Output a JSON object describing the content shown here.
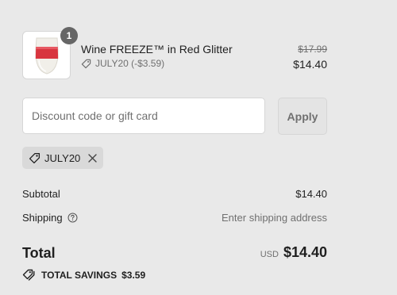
{
  "cart": {
    "item": {
      "quantity": "1",
      "title": "Wine FREEZE™ in Red Glitter",
      "discount": "JULY20 (-$3.59)",
      "original_price": "$17.99",
      "price": "$14.40",
      "image_icon": "wine-glass-image"
    }
  },
  "discount": {
    "placeholder": "Discount code or gift card",
    "value": "",
    "apply_label": "Apply",
    "applied_code": "JULY20"
  },
  "summary": {
    "subtotal_label": "Subtotal",
    "subtotal_value": "$14.40",
    "shipping_label": "Shipping",
    "shipping_value": "Enter shipping address",
    "total_label": "Total",
    "currency": "USD",
    "total_value": "$14.40",
    "savings_label": "TOTAL SAVINGS",
    "savings_value": "$3.59"
  },
  "colors": {
    "background": "#e9e9e9",
    "badge": "#666666",
    "glass_red": "#d8353f",
    "muted_text": "#707070"
  }
}
